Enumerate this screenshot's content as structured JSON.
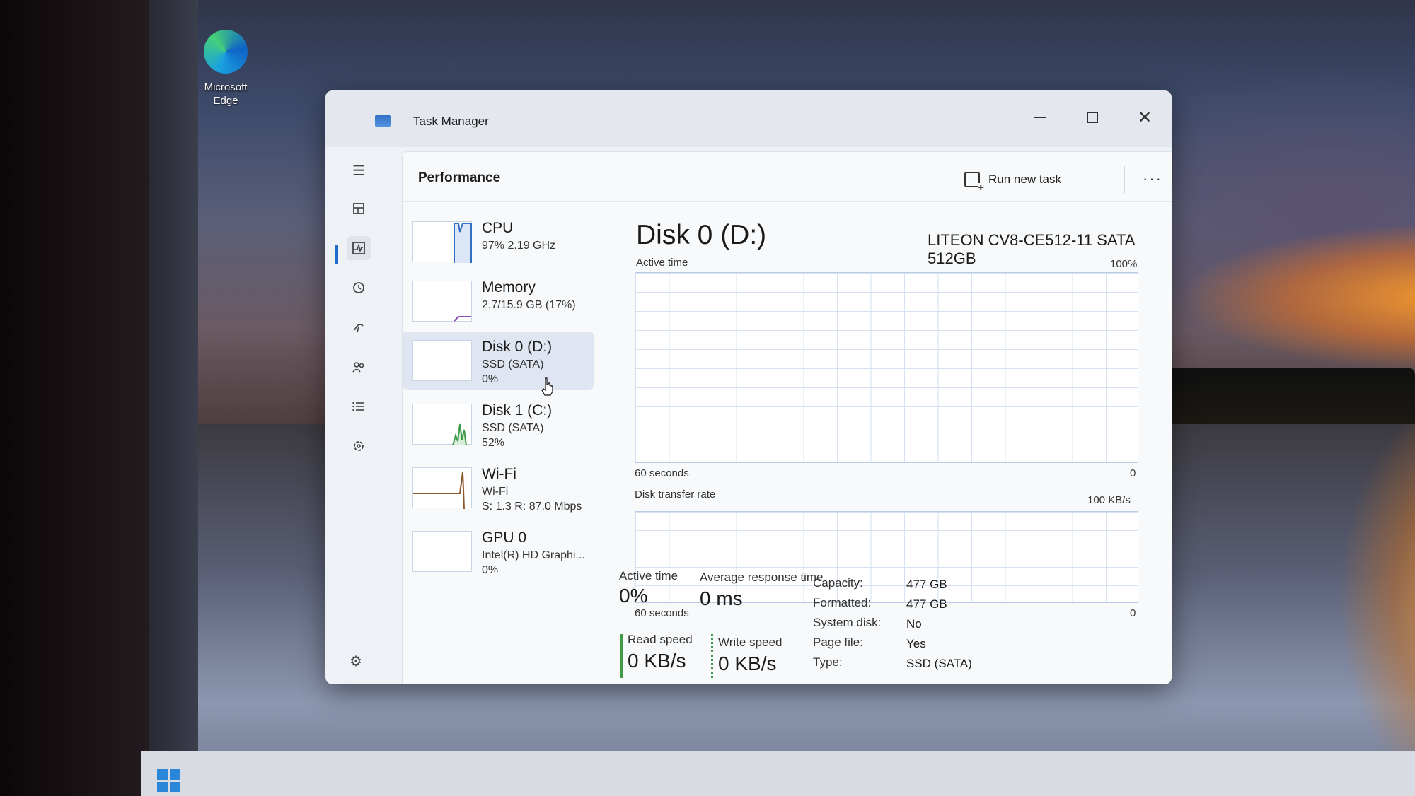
{
  "desktop": {
    "edge_label_line1": "Microsoft",
    "edge_label_line2": "Edge"
  },
  "window": {
    "title": "Task Manager",
    "minimize_icon": "minimize-icon",
    "maximize_icon": "maximize-icon",
    "close_icon": "close-icon"
  },
  "nav": {
    "items": [
      "hamburger-icon",
      "processes-icon",
      "performance-icon",
      "app-history-icon",
      "startup-apps-icon",
      "users-icon",
      "details-icon",
      "services-icon"
    ],
    "settings_icon": "settings-icon"
  },
  "header": {
    "title": "Performance",
    "run_new_task": "Run new task",
    "more": "···"
  },
  "resources": [
    {
      "name": "CPU",
      "sub1": "97% 2.19 GHz",
      "sub2": ""
    },
    {
      "name": "Memory",
      "sub1": "2.7/15.9 GB (17%)",
      "sub2": ""
    },
    {
      "name": "Disk 0 (D:)",
      "sub1": "SSD (SATA)",
      "sub2": "0%"
    },
    {
      "name": "Disk 1 (C:)",
      "sub1": "SSD (SATA)",
      "sub2": "52%"
    },
    {
      "name": "Wi-Fi",
      "sub1": "Wi-Fi",
      "sub2": "S: 1.3 R: 87.0 Mbps"
    },
    {
      "name": "GPU 0",
      "sub1": "Intel(R) HD Graphi...",
      "sub2": "0%"
    }
  ],
  "detail": {
    "title": "Disk 0 (D:)",
    "model": "LITEON CV8-CE512-11 SATA 512GB",
    "graph1_label": "Active time",
    "graph1_max": "100%",
    "graph1_time": "60 seconds",
    "graph1_min": "0",
    "graph2_label": "Disk transfer rate",
    "graph2_max": "100 KB/s",
    "graph2_time": "60 seconds",
    "graph2_min": "0",
    "stats": {
      "active_time_label": "Active time",
      "active_time_value": "0%",
      "avg_response_label": "Average response time",
      "avg_response_value": "0 ms",
      "read_label": "Read speed",
      "read_value": "0 KB/s",
      "write_label": "Write speed",
      "write_value": "0 KB/s"
    },
    "properties": {
      "capacity_k": "Capacity:",
      "capacity_v": "477 GB",
      "formatted_k": "Formatted:",
      "formatted_v": "477 GB",
      "system_k": "System disk:",
      "system_v": "No",
      "pagefile_k": "Page file:",
      "pagefile_v": "Yes",
      "type_k": "Type:",
      "type_v": "SSD (SATA)"
    }
  },
  "colors": {
    "accent": "#1f6bc9",
    "disk_green": "#3f9b48",
    "cpu_blue": "#2f6fc4",
    "selected_bg": "#dfe6f1"
  }
}
